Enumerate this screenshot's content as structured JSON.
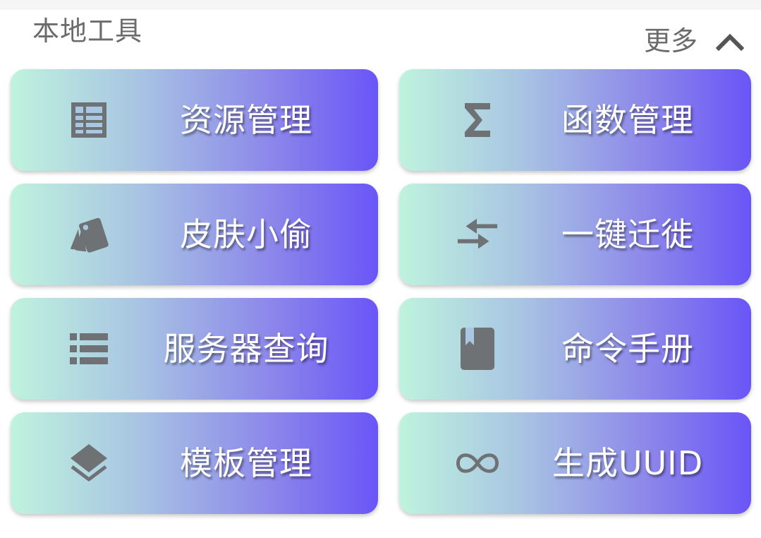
{
  "header": {
    "section_title": "本地工具",
    "more_label": "更多"
  },
  "tools": [
    {
      "label": "资源管理",
      "icon": "table-icon"
    },
    {
      "label": "函数管理",
      "icon": "sigma-icon"
    },
    {
      "label": "皮肤小偷",
      "icon": "swatch-cards-icon"
    },
    {
      "label": "一键迁徙",
      "icon": "compare-arrows-icon"
    },
    {
      "label": "服务器查询",
      "icon": "list-icon"
    },
    {
      "label": "命令手册",
      "icon": "bookmark-book-icon"
    },
    {
      "label": "模板管理",
      "icon": "layers-icon"
    },
    {
      "label": "生成UUID",
      "icon": "infinity-icon"
    }
  ],
  "colors": {
    "gradient_start": "#bff3de",
    "gradient_end": "#6a55f7",
    "icon": "#6e7275",
    "label": "#ffffff",
    "header_text": "#6b6b6b"
  }
}
